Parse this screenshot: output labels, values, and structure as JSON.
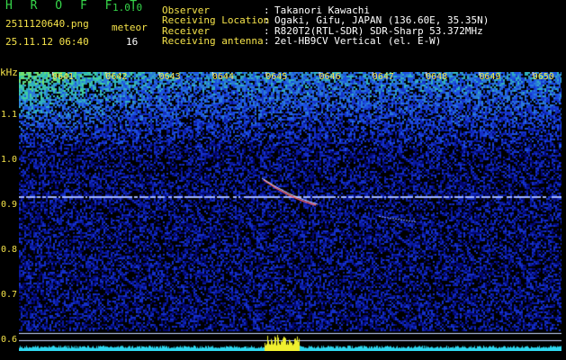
{
  "app": {
    "name": "H R O F F T",
    "version": "1.0.0"
  },
  "capture": {
    "filename": "2511120640.png",
    "datetime": "25.11.12 06:40",
    "type_label": "meteor",
    "count": "16"
  },
  "meta": [
    {
      "key": "Observer",
      "value": "Takanori Kawachi"
    },
    {
      "key": "Receiving Location",
      "value": "Ogaki, Gifu, JAPAN (136.60E, 35.35N)"
    },
    {
      "key": "Receiver",
      "value": "R820T2(RTL-SDR) SDR-Sharp 53.372MHz"
    },
    {
      "key": "Receiving antenna",
      "value": "2el-HB9CV Vertical (el. E-W)"
    }
  ],
  "axes": {
    "y_unit": "kHz",
    "y_ticks": [
      "1.1",
      "1.0",
      "0.9",
      "0.8",
      "0.7",
      "0.6"
    ],
    "x_ticks": [
      "0641",
      "0642",
      "0643",
      "0644",
      "0645",
      "0646",
      "0647",
      "0648",
      "0649",
      "0650"
    ]
  },
  "colors": {
    "background": "#000000",
    "header_green": "#36d64a",
    "axis_yellow": "#f5e34a",
    "noise_floor": "#0a1aa0",
    "carrier_line": "#a0b4ff",
    "meteor_trail": "#ff6060",
    "activity_bar": "#30d8f0",
    "activity_peak": "#f0f030"
  },
  "chart_data": {
    "type": "heatmap",
    "title": "",
    "xlabel": "",
    "ylabel": "kHz",
    "x_ticks": [
      "0641",
      "0642",
      "0643",
      "0644",
      "0645",
      "0646",
      "0647",
      "0648",
      "0649",
      "0650"
    ],
    "y_ticks": [
      1.1,
      1.0,
      0.9,
      0.8,
      0.7,
      0.6
    ],
    "ylim": [
      0.58,
      1.2
    ],
    "carrier_khz": 0.92,
    "meteor_trail": {
      "start": [
        "0645",
        0.96
      ],
      "end": [
        "0646",
        0.9
      ]
    }
  }
}
